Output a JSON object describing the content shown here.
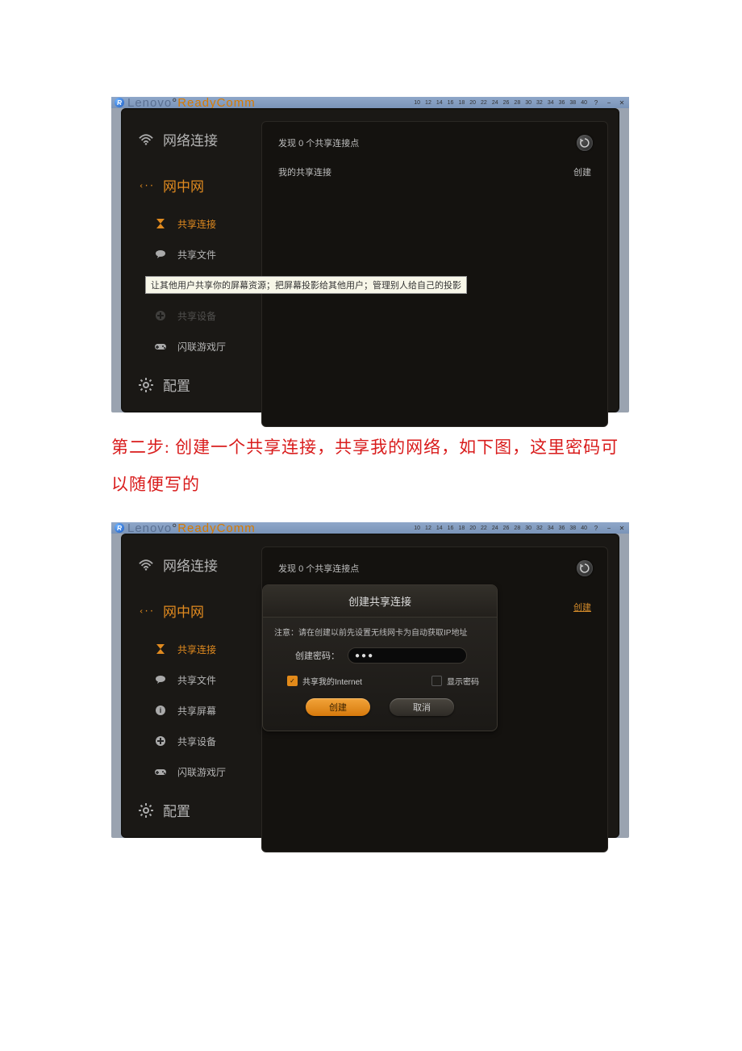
{
  "app": {
    "title_lenovo": "Lenovo",
    "title_ready": "ReadyComm",
    "ruler_ticks": [
      "10",
      "12",
      "14",
      "16",
      "18",
      "20",
      "22",
      "24",
      "26",
      "28",
      "30",
      "32",
      "34",
      "36",
      "38",
      "40"
    ]
  },
  "sidebar": {
    "network": "网络连接",
    "mesh": "网中网",
    "share_conn": "共享连接",
    "share_file": "共享文件",
    "share_screen": "共享屏幕",
    "share_device": "共享设备",
    "game_hall": "闪联游戏厅",
    "settings": "配置"
  },
  "panel": {
    "found_prefix": "发现 ",
    "found_count": "0",
    "found_suffix": " 个共享连接点",
    "my_share": "我的共享连接",
    "create": "创建"
  },
  "tooltip": "让其他用户共享你的屏幕资源；把屏幕投影给其他用户；管理别人给自己的投影",
  "caption": "第二步: 创建一个共享连接，共享我的网络，如下图，这里密码可以随便写的",
  "dialog": {
    "title": "创建共享连接",
    "note": "注意：请在创建以前先设置无线网卡为自动获取IP地址",
    "pw_label": "创建密码：",
    "pw_value": "●●●",
    "share_internet": "共享我的Internet",
    "show_pw": "显示密码",
    "create_btn": "创建",
    "cancel_btn": "取消"
  }
}
